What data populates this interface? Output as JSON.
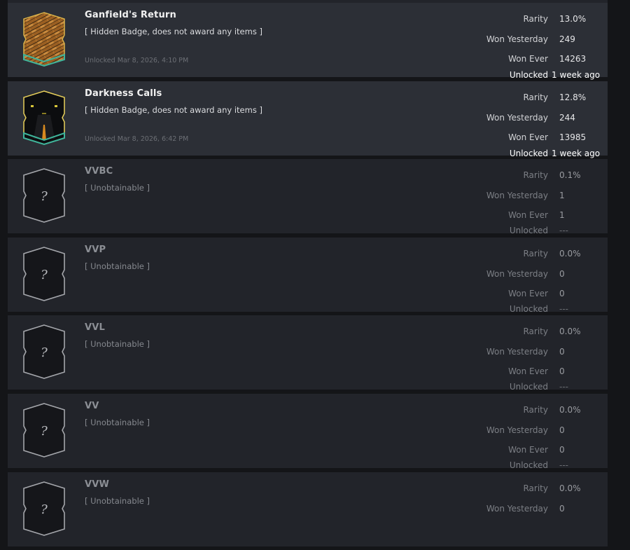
{
  "labels": {
    "rarity": "Rarity",
    "won_yesterday": "Won Yesterday",
    "won_ever": "Won Ever",
    "unlocked": "Unlocked"
  },
  "badges": [
    {
      "name": "Ganfield's Return",
      "desc": "[ Hidden Badge, does not award any items ]",
      "unlocked_at": "Unlocked Mar 8, 2026, 4:10 PM",
      "rarity": "13.0%",
      "won_yesterday": "249",
      "won_ever": "14263",
      "unlocked": "1 week ago",
      "icon": "brick-badge-icon"
    },
    {
      "name": "Darkness Calls",
      "desc": "[ Hidden Badge, does not award any items ]",
      "unlocked_at": "Unlocked Mar 8, 2026, 6:42 PM",
      "rarity": "12.8%",
      "won_yesterday": "244",
      "won_ever": "13985",
      "unlocked": "1 week ago",
      "icon": "dark-road-badge-icon"
    },
    {
      "name": "VVBC",
      "desc": "[ Unobtainable ]",
      "rarity": "0.1%",
      "won_yesterday": "1",
      "won_ever": "1",
      "unlocked": "---",
      "icon_text": "?"
    },
    {
      "name": "VVP",
      "desc": "[ Unobtainable ]",
      "rarity": "0.0%",
      "won_yesterday": "0",
      "won_ever": "0",
      "unlocked": "---",
      "icon_text": "?"
    },
    {
      "name": "VVL",
      "desc": "[ Unobtainable ]",
      "rarity": "0.0%",
      "won_yesterday": "0",
      "won_ever": "0",
      "unlocked": "---",
      "icon_text": "?"
    },
    {
      "name": "VV",
      "desc": "[ Unobtainable ]",
      "rarity": "0.0%",
      "won_yesterday": "0",
      "won_ever": "0",
      "unlocked": "---",
      "icon_text": "?"
    },
    {
      "name": "VVW",
      "desc": "[ Unobtainable ]",
      "rarity": "0.0%",
      "won_yesterday": "0",
      "icon_text": "?"
    }
  ]
}
